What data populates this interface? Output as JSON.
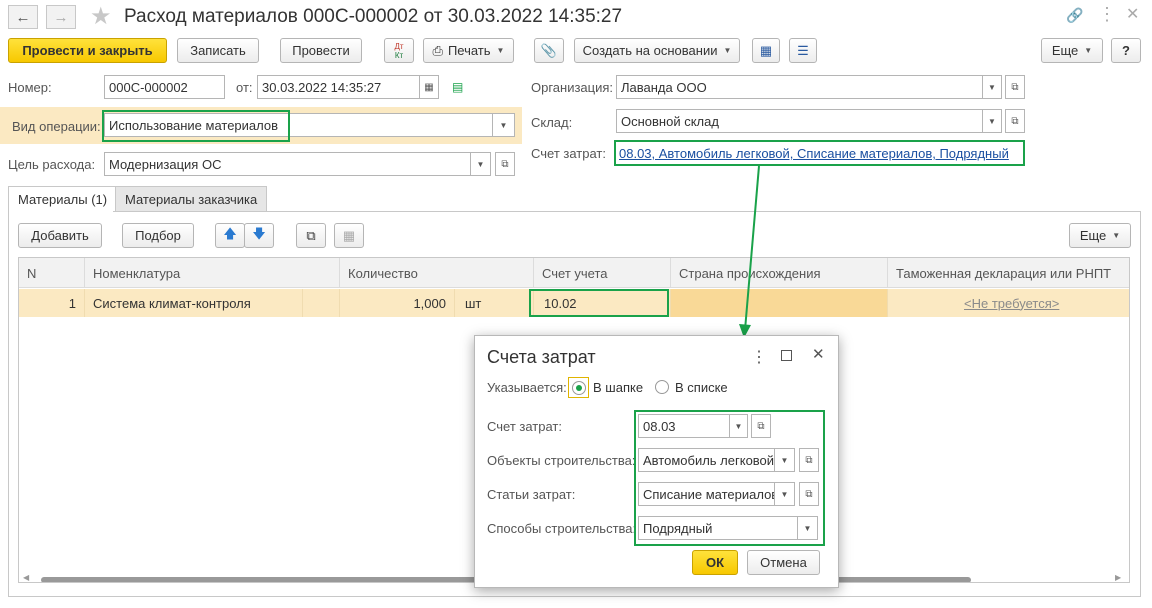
{
  "window": {
    "title": "Расход материалов 000С-000002 от 30.03.2022 14:35:27"
  },
  "toolbar": {
    "post_close": "Провести и закрыть",
    "save": "Записать",
    "post": "Провести",
    "dtkt_top": "Дт",
    "dtkt_bottom": "Кт",
    "print": "Печать",
    "create_based": "Создать на основании",
    "more": "Еще",
    "help": "?"
  },
  "header": {
    "number_label": "Номер:",
    "number_value": "000С-000002",
    "date_label": "от:",
    "date_value": "30.03.2022 14:35:27",
    "org_label": "Организация:",
    "org_value": "Лаванда ООО",
    "op_label": "Вид операции:",
    "op_value": "Использование материалов",
    "warehouse_label": "Склад:",
    "warehouse_value": "Основной склад",
    "purpose_label": "Цель расхода:",
    "purpose_value": "Модернизация ОС",
    "cost_account_label": "Счет затрат:",
    "cost_account_link": "08.03, Автомобиль легковой, Списание материалов, Подрядный"
  },
  "tabs": [
    {
      "label": "Материалы (1)"
    },
    {
      "label": "Материалы заказчика"
    }
  ],
  "table_toolbar": {
    "add": "Добавить",
    "pick": "Подбор",
    "more": "Еще"
  },
  "table": {
    "columns": [
      "N",
      "Номенклатура",
      "Количество",
      "Счет учета",
      "Страна происхождения",
      "Таможенная декларация или РНПТ"
    ],
    "rows": [
      {
        "n": "1",
        "item": "Система климат-контроля",
        "qty": "1,000",
        "unit": "шт",
        "account": "10.02",
        "country": "",
        "customs": "<Не требуется>"
      }
    ]
  },
  "dialog": {
    "title": "Счета затрат",
    "specified_label": "Указывается:",
    "option_header": "В шапке",
    "option_list": "В списке",
    "cost_account_label": "Счет затрат:",
    "cost_account_value": "08.03",
    "objects_label": "Объекты строительства:",
    "objects_value": "Автомобиль легковой",
    "cost_items_label": "Статьи затрат:",
    "cost_items_value": "Списание материалов",
    "methods_label": "Способы строительства:",
    "methods_value": "Подрядный",
    "ok": "ОК",
    "cancel": "Отмена"
  },
  "colors": {
    "accent_yellow": "#f7c800",
    "highlight_row": "#fbe9c2",
    "annotation_green": "#1aa24a",
    "link_blue": "#1a4fa0"
  }
}
